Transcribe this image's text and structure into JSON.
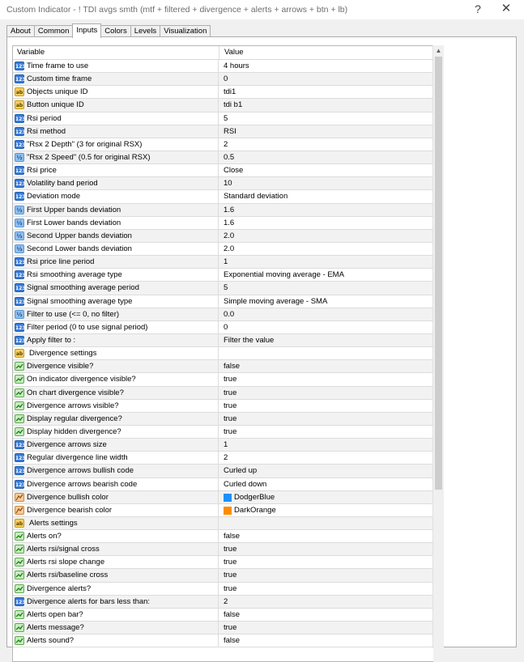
{
  "window": {
    "title": "Custom Indicator - ! TDI  avgs smth  (mtf + filtered + divergence + alerts + arrows + btn + lb)",
    "help_glyph": "?",
    "close_glyph": "✕"
  },
  "tabs": [
    {
      "label": "About",
      "active": false
    },
    {
      "label": "Common",
      "active": false
    },
    {
      "label": "Inputs",
      "active": true
    },
    {
      "label": "Colors",
      "active": false
    },
    {
      "label": "Levels",
      "active": false
    },
    {
      "label": "Visualization",
      "active": false
    }
  ],
  "table": {
    "col_variable": "Variable",
    "col_value": "Value",
    "rows": [
      {
        "type": "int",
        "icon": "int-param-icon",
        "name": "Time frame to use",
        "value": "4 hours"
      },
      {
        "type": "int",
        "icon": "int-param-icon",
        "name": "Custom time frame",
        "value": "0"
      },
      {
        "type": "string",
        "icon": "string-param-icon",
        "name": "Objects unique ID",
        "value": "tdi1"
      },
      {
        "type": "string",
        "icon": "string-param-icon",
        "name": "Button unique ID",
        "value": "tdi b1"
      },
      {
        "type": "int",
        "icon": "int-param-icon",
        "name": "Rsi period",
        "value": "5"
      },
      {
        "type": "int",
        "icon": "int-param-icon",
        "name": "Rsi method",
        "value": "RSI"
      },
      {
        "type": "int",
        "icon": "int-param-icon",
        "name": "\"Rsx 2 Depth\" (3 for original RSX)",
        "value": "2"
      },
      {
        "type": "float",
        "icon": "float-param-icon",
        "name": "\"Rsx 2 Speed\" (0.5 for original RSX)",
        "value": "0.5"
      },
      {
        "type": "int",
        "icon": "int-param-icon",
        "name": "Rsi price",
        "value": "Close"
      },
      {
        "type": "int",
        "icon": "int-param-icon",
        "name": "Volatility band period",
        "value": "10"
      },
      {
        "type": "int",
        "icon": "int-param-icon",
        "name": "Deviation mode",
        "value": "Standard deviation"
      },
      {
        "type": "float",
        "icon": "float-param-icon",
        "name": "First Upper bands deviation",
        "value": "1.6"
      },
      {
        "type": "float",
        "icon": "float-param-icon",
        "name": "First Lower bands deviation",
        "value": "1.6"
      },
      {
        "type": "float",
        "icon": "float-param-icon",
        "name": "Second Upper bands deviation",
        "value": "2.0"
      },
      {
        "type": "float",
        "icon": "float-param-icon",
        "name": "Second Lower bands deviation",
        "value": "2.0"
      },
      {
        "type": "int",
        "icon": "int-param-icon",
        "name": "Rsi price line period",
        "value": "1"
      },
      {
        "type": "int",
        "icon": "int-param-icon",
        "name": "Rsi smoothing average type",
        "value": "Exponential moving average - EMA"
      },
      {
        "type": "int",
        "icon": "int-param-icon",
        "name": "Signal smoothing average period",
        "value": "5"
      },
      {
        "type": "int",
        "icon": "int-param-icon",
        "name": "Signal smoothing average type",
        "value": "Simple moving average - SMA"
      },
      {
        "type": "float",
        "icon": "float-param-icon",
        "name": "Filter to use (<= 0, no filter)",
        "value": "0.0"
      },
      {
        "type": "int",
        "icon": "int-param-icon",
        "name": "Filter period (0 to use signal period)",
        "value": "0"
      },
      {
        "type": "int",
        "icon": "int-param-icon",
        "name": "Apply filter to :",
        "value": "Filter the value"
      },
      {
        "type": "section",
        "icon": "string-param-icon",
        "name": "Divergence settings",
        "value": ""
      },
      {
        "type": "bool",
        "icon": "bool-param-icon",
        "name": "Divergence visible?",
        "value": "false"
      },
      {
        "type": "bool",
        "icon": "bool-param-icon",
        "name": "On indicator divergence visible?",
        "value": "true"
      },
      {
        "type": "bool",
        "icon": "bool-param-icon",
        "name": "On chart divergence visible?",
        "value": "true"
      },
      {
        "type": "bool",
        "icon": "bool-param-icon",
        "name": "Divergence arrows visible?",
        "value": "true"
      },
      {
        "type": "bool",
        "icon": "bool-param-icon",
        "name": "Display regular divergence?",
        "value": "true"
      },
      {
        "type": "bool",
        "icon": "bool-param-icon",
        "name": "Display hidden divergence?",
        "value": "true"
      },
      {
        "type": "int",
        "icon": "int-param-icon",
        "name": "Divergence arrows size",
        "value": "1"
      },
      {
        "type": "int",
        "icon": "int-param-icon",
        "name": "Regular divergence line width",
        "value": "2"
      },
      {
        "type": "int",
        "icon": "int-param-icon",
        "name": "Divergence arrows bullish code",
        "value": "Curled up"
      },
      {
        "type": "int",
        "icon": "int-param-icon",
        "name": "Divergence arrows bearish code",
        "value": "Curled down"
      },
      {
        "type": "color",
        "icon": "color-param-icon",
        "name": "Divergence bullish color",
        "value": "DodgerBlue",
        "swatch": "#1e90ff"
      },
      {
        "type": "color",
        "icon": "color-param-icon",
        "name": "Divergence bearish color",
        "value": "DarkOrange",
        "swatch": "#ff8c00"
      },
      {
        "type": "section",
        "icon": "string-param-icon",
        "name": "Alerts settings",
        "value": ""
      },
      {
        "type": "bool",
        "icon": "bool-param-icon",
        "name": "Alerts on?",
        "value": "false"
      },
      {
        "type": "bool",
        "icon": "bool-param-icon",
        "name": "Alerts rsi/signal cross",
        "value": "true"
      },
      {
        "type": "bool",
        "icon": "bool-param-icon",
        "name": "Alerts rsi slope change",
        "value": "true"
      },
      {
        "type": "bool",
        "icon": "bool-param-icon",
        "name": "Alerts rsi/baseline cross",
        "value": "true"
      },
      {
        "type": "bool",
        "icon": "bool-param-icon",
        "name": "Divergence alerts?",
        "value": "true"
      },
      {
        "type": "int",
        "icon": "int-param-icon",
        "name": "Divergence alerts for bars less than:",
        "value": "2"
      },
      {
        "type": "bool",
        "icon": "bool-param-icon",
        "name": "Alerts open bar?",
        "value": "false"
      },
      {
        "type": "bool",
        "icon": "bool-param-icon",
        "name": "Alerts message?",
        "value": "true"
      },
      {
        "type": "bool",
        "icon": "bool-param-icon",
        "name": "Alerts sound?",
        "value": "false"
      }
    ]
  },
  "scrollbar": {
    "up_glyph": "▲"
  }
}
